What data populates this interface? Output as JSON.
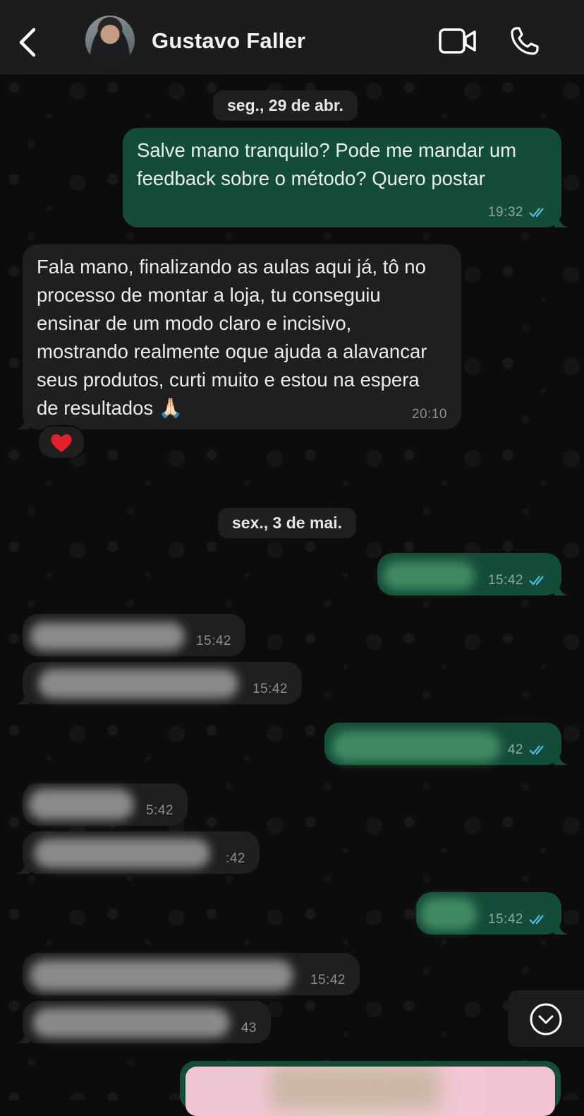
{
  "header": {
    "contact_name": "Gustavo Faller",
    "back_icon": "chevron-left-icon",
    "video_icon": "video-camera-icon",
    "call_icon": "phone-icon"
  },
  "dates": {
    "first": "seg., 29 de abr.",
    "second": "sex., 3 de mai."
  },
  "messages": [
    {
      "direction": "out",
      "text": "Salve mano tranquilo? Pode me mandar um feedback sobre o método? Quero postar",
      "time": "19:32",
      "read": true
    },
    {
      "direction": "in",
      "text": "Fala mano, finalizando as aulas aqui já, tô no processo de montar a loja, tu conseguiu ensinar de um modo claro e incisivo, mostrando realmente oque ajuda a alavancar seus produtos, curti muito e estou na espera de resultados 🙏🏻",
      "time": "20:10",
      "reaction": "❤️"
    },
    {
      "direction": "out",
      "text": "",
      "time": "15:42",
      "read": true
    },
    {
      "direction": "in",
      "text": "",
      "time": "15:42"
    },
    {
      "direction": "in",
      "text": "",
      "time": "15:42"
    },
    {
      "direction": "out",
      "text": "",
      "time": "42",
      "read": true
    },
    {
      "direction": "in",
      "text": "",
      "time": "5:42"
    },
    {
      "direction": "in",
      "text": "",
      "time": ":42"
    },
    {
      "direction": "out",
      "text": "",
      "time": "15:42",
      "read": true
    },
    {
      "direction": "in",
      "text": "",
      "time": "15:42"
    },
    {
      "direction": "in",
      "text": "",
      "time": "43"
    }
  ],
  "scroll_button_icon": "chevron-down-circle-icon",
  "colors": {
    "outgoing_bubble": "#144d37",
    "incoming_bubble": "#1f1f20",
    "read_ticks": "#53bdeb",
    "background": "#0b0b0b"
  }
}
